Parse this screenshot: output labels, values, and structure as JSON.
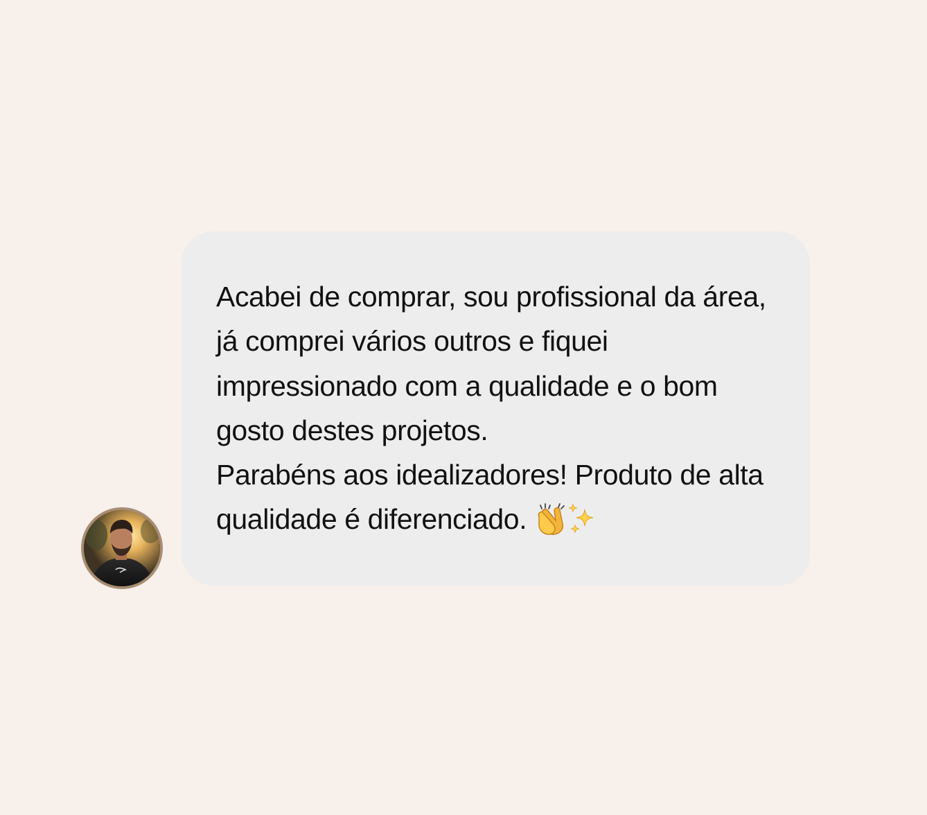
{
  "message": {
    "lines": [
      "Acabei de comprar, sou profissional da área,",
      "já comprei vários outros e fiquei",
      "impressionado com a qualidade e o bom",
      "gosto destes projetos.",
      "Parabéns aos idealizadores! Produto de alta",
      "qualidade é diferenciado."
    ],
    "emoji": [
      "clapping-hands",
      "sparkles"
    ]
  },
  "colors": {
    "background": "#f7f0eb",
    "bubble": "#ededed",
    "text": "#111111",
    "avatar_border": "#a88d73"
  }
}
